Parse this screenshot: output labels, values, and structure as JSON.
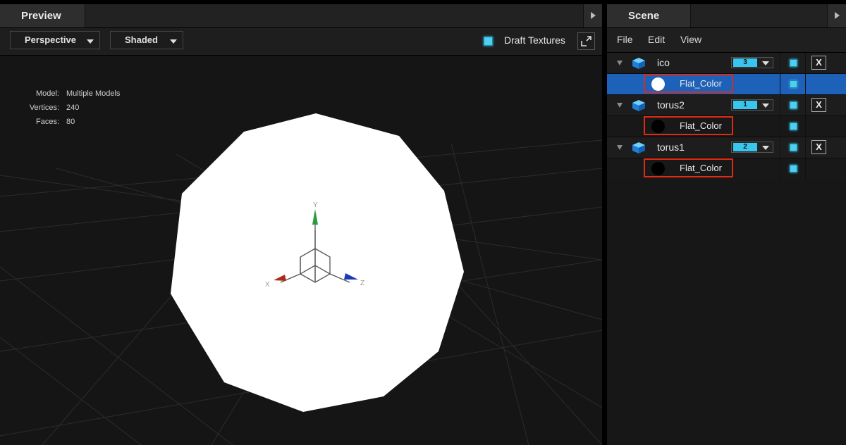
{
  "preview": {
    "title": "Preview",
    "projection_dropdown": "Perspective",
    "shading_dropdown": "Shaded",
    "draft_textures_label": "Draft Textures",
    "draft_textures_checked": true,
    "stats": {
      "model_label": "Model:",
      "model_value": "Multiple Models",
      "vertices_label": "Vertices:",
      "vertices_value": "240",
      "faces_label": "Faces:",
      "faces_value": "80"
    },
    "gizmo": {
      "y_label": "Y",
      "x_label": "X",
      "z_label": "Z"
    }
  },
  "scene": {
    "title": "Scene",
    "menu": {
      "file": "File",
      "edit": "Edit",
      "view": "View"
    },
    "nodes": [
      {
        "name": "ico",
        "count": "3",
        "material": "Flat_Color",
        "material_color": "#ffffff",
        "selected_material": true
      },
      {
        "name": "torus2",
        "count": "1",
        "material": "Flat_Color",
        "material_color": "#000000",
        "selected_material": false
      },
      {
        "name": "torus1",
        "count": "2",
        "material": "Flat_Color",
        "material_color": "#000000",
        "selected_material": false
      }
    ],
    "delete_label": "X"
  },
  "colors": {
    "accent": "#39c6ee",
    "selection": "#1e61b9",
    "highlight_box": "#e02a14",
    "axis_x": "#b02a1a",
    "axis_y": "#2a9a3a",
    "axis_z": "#1a3ab8"
  }
}
